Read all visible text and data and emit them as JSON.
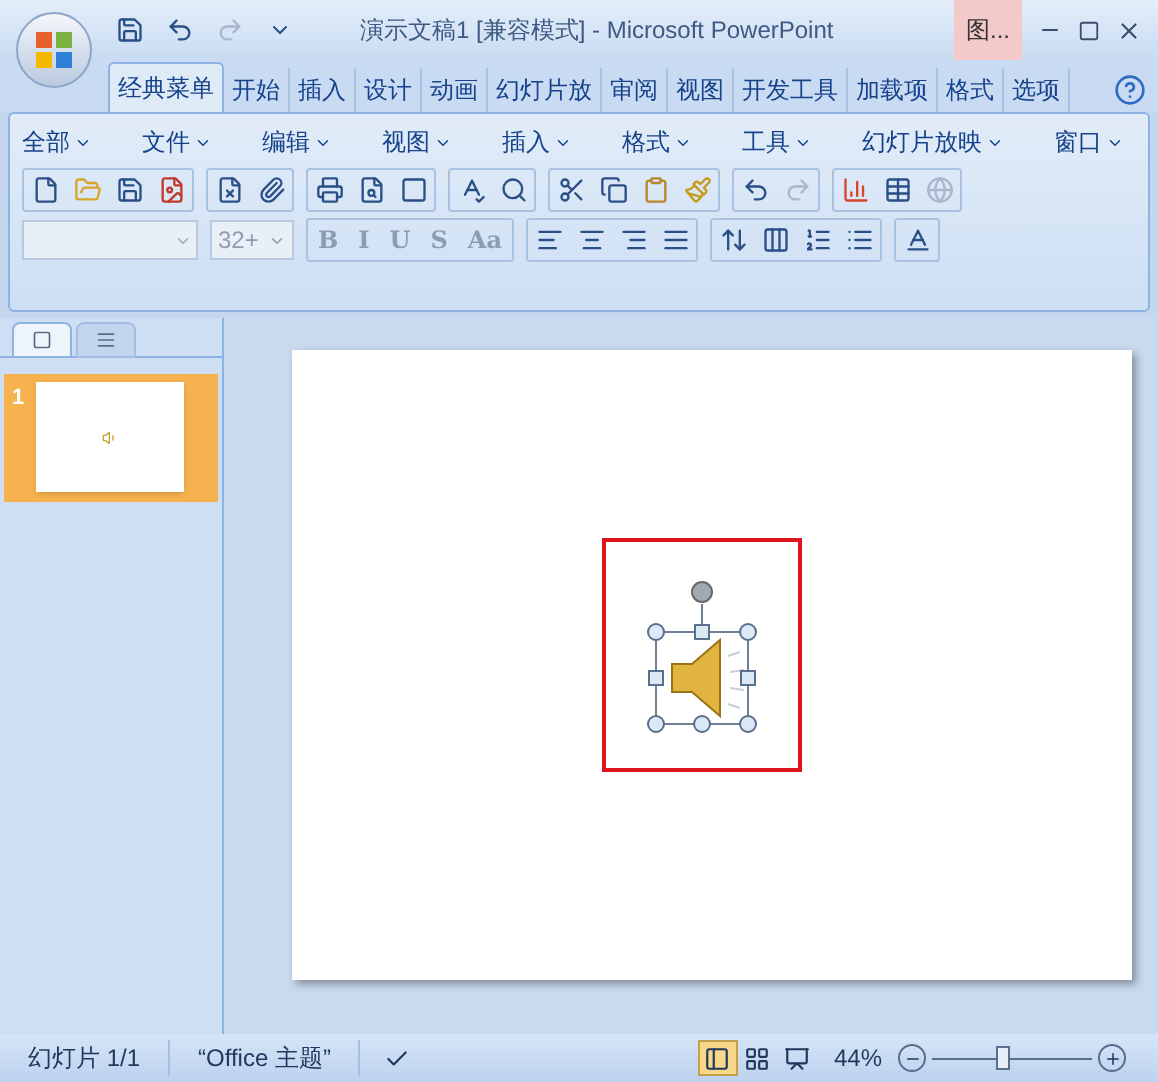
{
  "title_bar": {
    "document_title": "演示文稿1 [兼容模式] - Microsoft PowerPoint",
    "context_tab": "图..."
  },
  "ribbon_tabs": [
    {
      "label": "经典菜单",
      "selected": true
    },
    {
      "label": "开始",
      "selected": false
    },
    {
      "label": "插入",
      "selected": false
    },
    {
      "label": "设计",
      "selected": false
    },
    {
      "label": "动画",
      "selected": false
    },
    {
      "label": "幻灯片放",
      "selected": false
    },
    {
      "label": "审阅",
      "selected": false
    },
    {
      "label": "视图",
      "selected": false
    },
    {
      "label": "开发工具",
      "selected": false
    },
    {
      "label": "加载项",
      "selected": false
    },
    {
      "label": "格式",
      "selected": false
    },
    {
      "label": "选项",
      "selected": false
    }
  ],
  "menus": [
    "全部",
    "文件",
    "编辑",
    "视图",
    "插入",
    "格式",
    "工具",
    "幻灯片放映",
    "窗口"
  ],
  "font_size_field": {
    "value": "32+"
  },
  "format_buttons": [
    "B",
    "I",
    "U",
    "S",
    "Aa"
  ],
  "outline_tabs": [
    {
      "kind": "slides",
      "selected": true
    },
    {
      "kind": "outline",
      "selected": false
    }
  ],
  "slides": [
    {
      "number": "1",
      "selected": true
    }
  ],
  "status_bar": {
    "slide_info": "幻灯片 1/1",
    "theme": "“Office 主题”",
    "views": [
      {
        "kind": "normal",
        "selected": true
      },
      {
        "kind": "sorter",
        "selected": false
      },
      {
        "kind": "show",
        "selected": false
      }
    ],
    "zoom": "44%",
    "level": 0.44
  }
}
